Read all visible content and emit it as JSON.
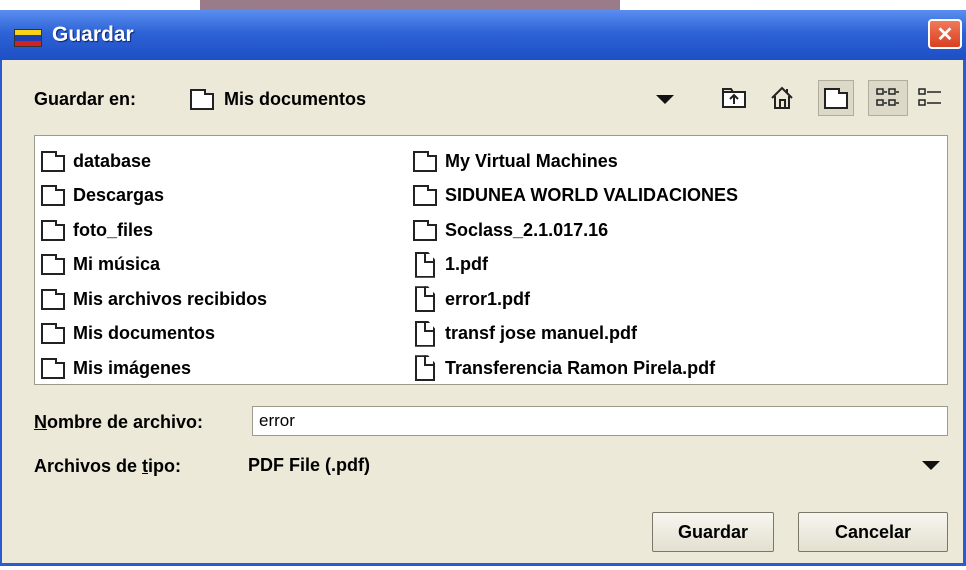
{
  "window": {
    "title": "Guardar",
    "close_glyph": "✕",
    "flag_colors": [
      "#f7d417",
      "#1a3fb0",
      "#d42020"
    ],
    "title_bar_color": "#2d63d6",
    "close_color": "#d84020"
  },
  "save_in": {
    "label": "Guardar en:",
    "selected": "Mis documentos"
  },
  "toolbar": {
    "up_icon": "up-folder-icon",
    "home_icon": "home-icon",
    "new_folder_icon": "new-folder-icon",
    "list_view_icon": "list-view-icon",
    "details_view_icon": "details-view-icon"
  },
  "files": {
    "col1": [
      {
        "name": "database",
        "type": "folder"
      },
      {
        "name": "Descargas",
        "type": "folder"
      },
      {
        "name": "foto_files",
        "type": "folder"
      },
      {
        "name": "Mi música",
        "type": "folder"
      },
      {
        "name": "Mis archivos recibidos",
        "type": "folder"
      },
      {
        "name": "Mis documentos",
        "type": "folder"
      },
      {
        "name": "Mis imágenes",
        "type": "folder"
      }
    ],
    "col2": [
      {
        "name": "My Virtual Machines",
        "type": "folder"
      },
      {
        "name": "SIDUNEA WORLD VALIDACIONES",
        "type": "folder"
      },
      {
        "name": "Soclass_2.1.017.16",
        "type": "folder"
      },
      {
        "name": "1.pdf",
        "type": "file"
      },
      {
        "name": "error1.pdf",
        "type": "file"
      },
      {
        "name": "transf jose manuel.pdf",
        "type": "file"
      },
      {
        "name": "Transferencia Ramon Pirela.pdf",
        "type": "file"
      }
    ]
  },
  "filename": {
    "label_prefix": "N",
    "label_rest": "ombre de archivo:",
    "value": "error"
  },
  "filetype": {
    "label_prefix": "Archivos de ",
    "label_mnemonic": "t",
    "label_rest": "ipo:",
    "selected": "PDF File (.pdf)"
  },
  "buttons": {
    "save": "Guardar",
    "cancel": "Cancelar"
  }
}
